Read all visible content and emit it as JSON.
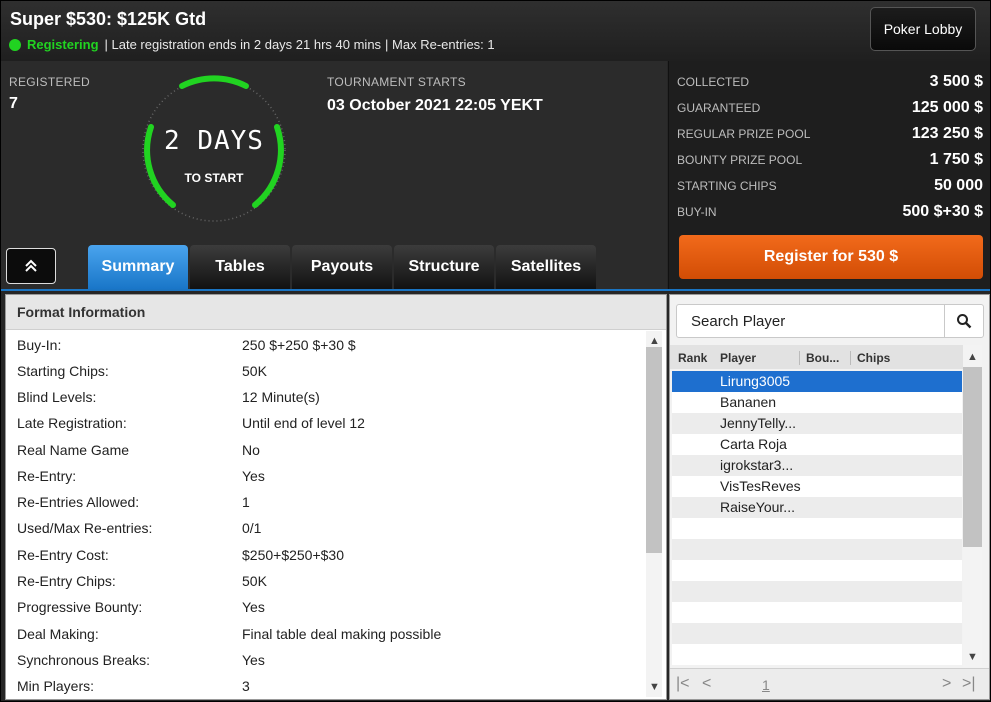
{
  "header": {
    "title": "Super $530: $125K Gtd",
    "status": "Registering",
    "late_reg": "| Late registration ends in 2 days 21 hrs  40 mins",
    "max_reentries": "| Max Re-entries: 1",
    "lobby_button": "Poker Lobby"
  },
  "summary": {
    "registered_label": "REGISTERED",
    "registered_value": "7",
    "countdown_value": "2 DAYS",
    "countdown_sub": "TO START",
    "starts_label": "TOURNAMENT STARTS",
    "starts_value": "03 October 2021  22:05 YEKT"
  },
  "tabs": [
    {
      "label": "Summary",
      "active": true
    },
    {
      "label": "Tables"
    },
    {
      "label": "Payouts"
    },
    {
      "label": "Structure"
    },
    {
      "label": "Satellites"
    }
  ],
  "stats": [
    {
      "label": "COLLECTED",
      "value": "3 500 $"
    },
    {
      "label": "GUARANTEED",
      "value": "125 000 $"
    },
    {
      "label": "REGULAR PRIZE POOL",
      "value": "123 250 $"
    },
    {
      "label": "BOUNTY PRIZE POOL",
      "value": "1 750 $"
    },
    {
      "label": "STARTING CHIPS",
      "value": "50 000"
    },
    {
      "label": "BUY-IN",
      "value": "500 $+30 $"
    }
  ],
  "register_button": "Register for  530 $",
  "format": {
    "heading": "Format Information",
    "rows": [
      {
        "k": "Buy-In:",
        "v": "250 $+250 $+30 $"
      },
      {
        "k": "Starting Chips:",
        "v": "50K"
      },
      {
        "k": "Blind Levels:",
        "v": "12 Minute(s)"
      },
      {
        "k": "Late Registration:",
        "v": "Until end of level 12"
      },
      {
        "k": "Real Name Game",
        "v": "No"
      },
      {
        "k": "Re-Entry:",
        "v": "Yes"
      },
      {
        "k": "Re-Entries Allowed:",
        "v": "1"
      },
      {
        "k": "Used/Max Re-entries:",
        "v": "0/1"
      },
      {
        "k": "Re-Entry Cost:",
        "v": "$250+$250+$30"
      },
      {
        "k": "Re-Entry Chips:",
        "v": "50K"
      },
      {
        "k": "Progressive Bounty:",
        "v": "Yes"
      },
      {
        "k": "Deal Making:",
        "v": "Final table deal making possible"
      },
      {
        "k": "Synchronous Breaks:",
        "v": "Yes"
      },
      {
        "k": "Min Players:",
        "v": "3"
      }
    ]
  },
  "players": {
    "search_placeholder": "Search Player",
    "columns": [
      "Rank",
      "Player",
      "Bou...",
      "Chips"
    ],
    "rows": [
      "Lirung3005",
      "Bananen",
      "JennyTelly...",
      "Carta Roja",
      "igrokstar3...",
      "VisTesReves",
      "RaiseYour..."
    ],
    "page": "1"
  }
}
